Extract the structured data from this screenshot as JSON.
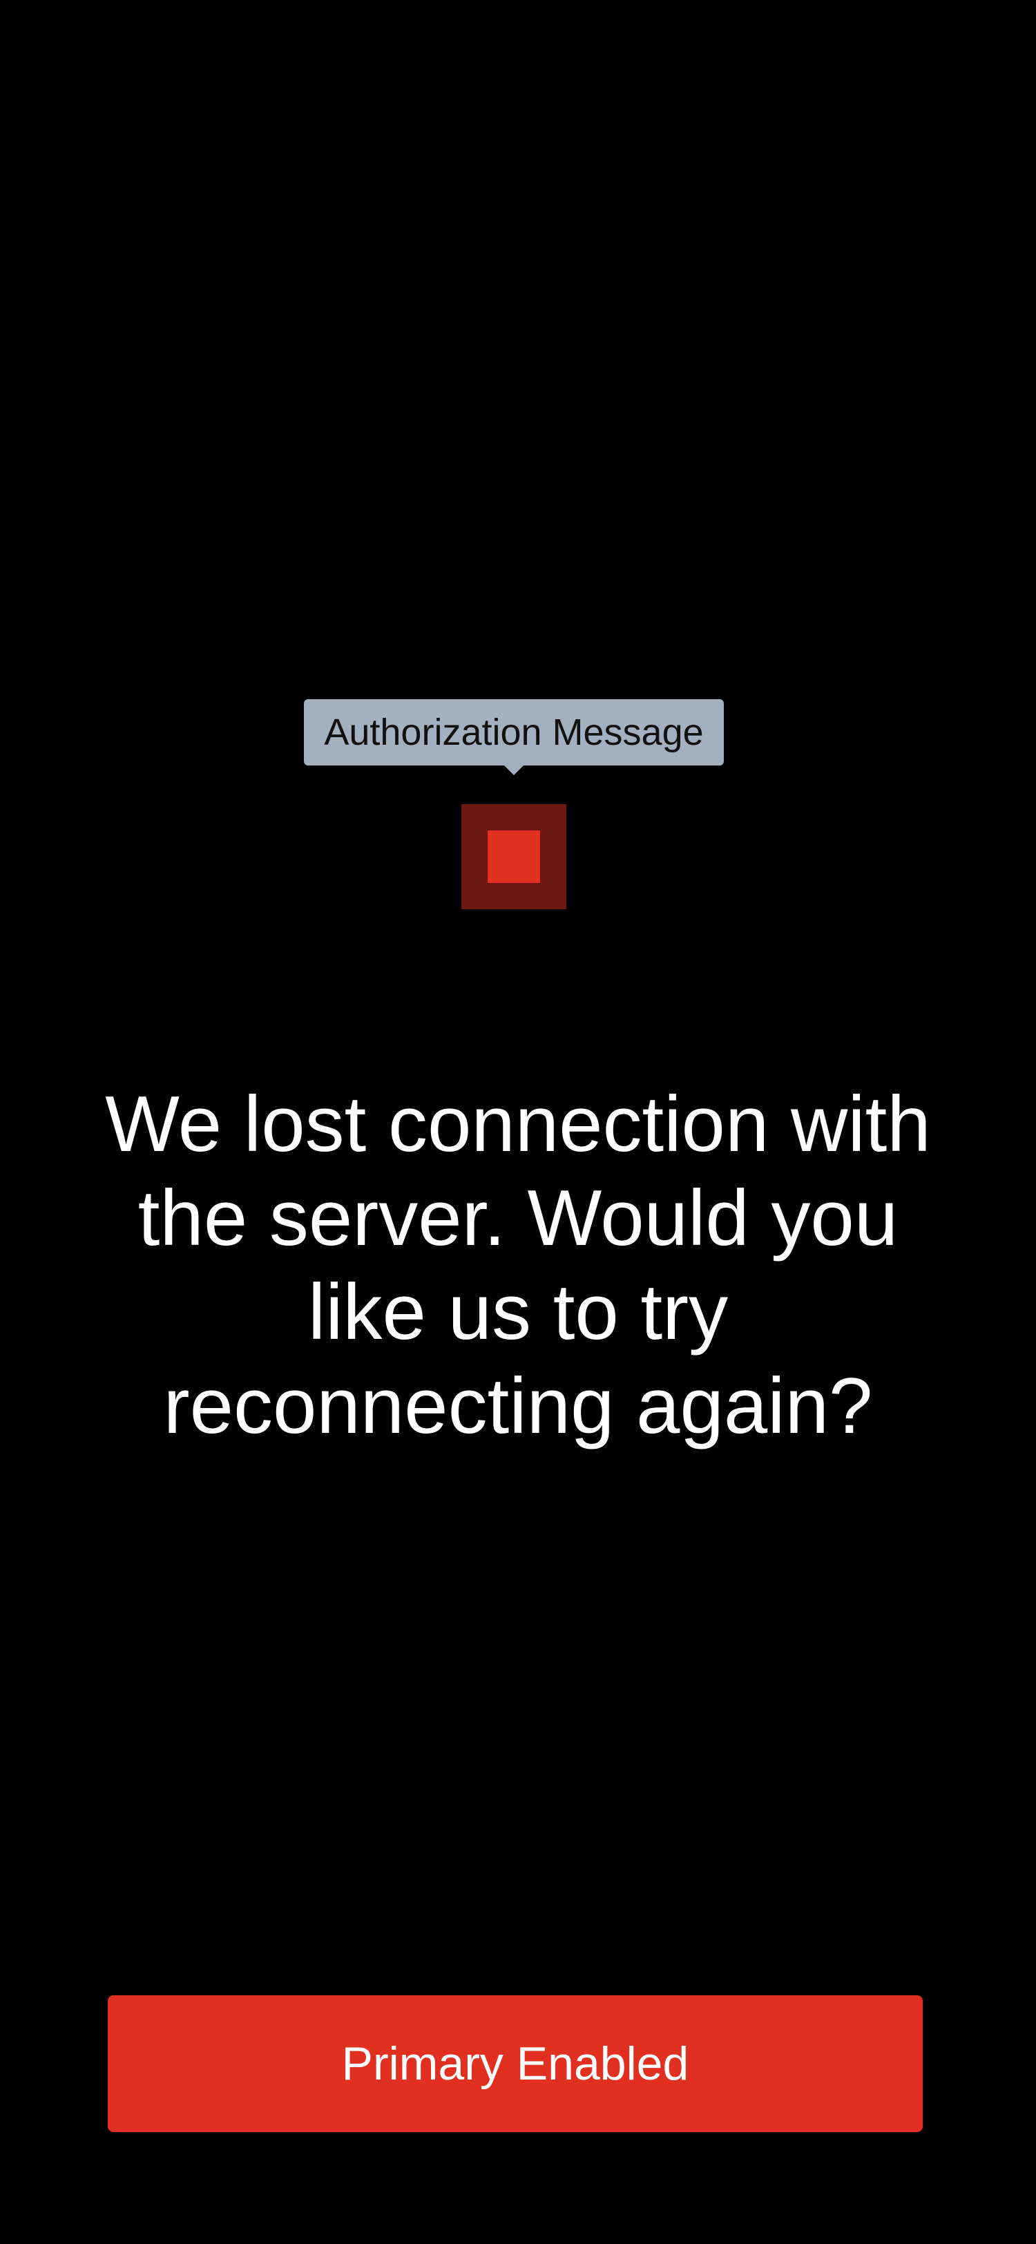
{
  "tooltip": {
    "text": "Authorization Message"
  },
  "status_icon": {
    "name": "error-square-icon",
    "outer_color": "#6e1712",
    "inner_color": "#e1301f"
  },
  "message": {
    "text": "We lost connection with the server. Would you like us to try reconnecting again?"
  },
  "primary_button": {
    "label": "Primary Enabled",
    "color": "#e1301f"
  },
  "colors": {
    "background": "#000000",
    "tooltip_bg": "#a2b0bf",
    "accent": "#e1301f",
    "text": "#ffffff"
  }
}
